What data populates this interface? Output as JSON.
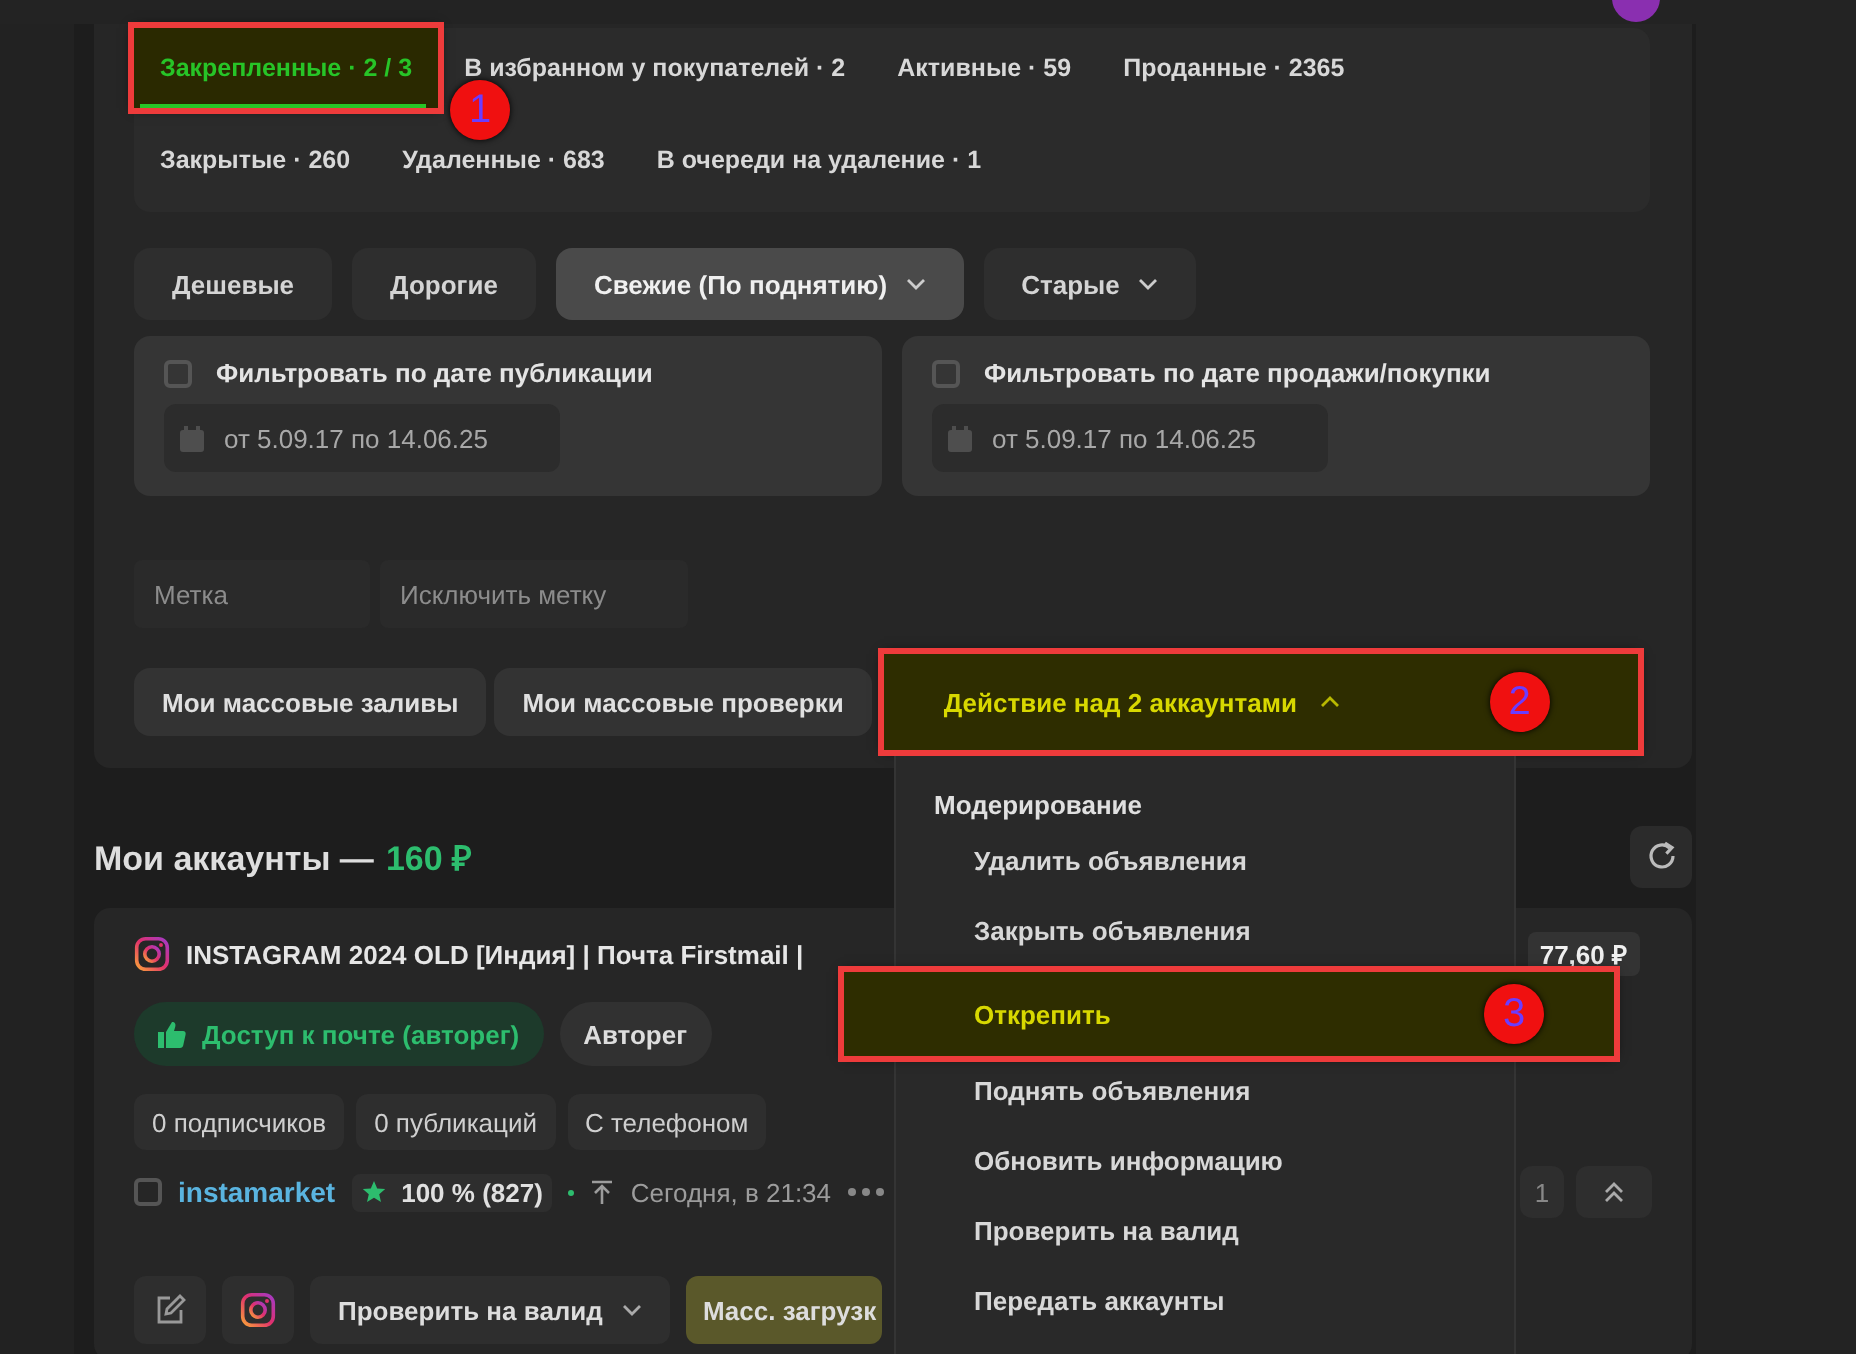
{
  "tab_rows": [
    [
      {
        "label": "Закрепленные · 2 / 3",
        "selected": true,
        "marker": "1"
      },
      {
        "label": "В избранном у покупателей · 2",
        "selected": false
      },
      {
        "label": "Активные · 59",
        "selected": false
      },
      {
        "label": "Проданные · 2365",
        "selected": false
      }
    ],
    [
      {
        "label": "Закрытые · 260",
        "selected": false
      },
      {
        "label": "Удаленные · 683",
        "selected": false
      },
      {
        "label": "В очереди на удаление · 1",
        "selected": false
      }
    ]
  ],
  "sort_buttons": [
    {
      "label": "Дешевые",
      "selected": false,
      "has_caret": false
    },
    {
      "label": "Дорогие",
      "selected": false,
      "has_caret": false
    },
    {
      "label": "Свежие (По поднятию)",
      "selected": true,
      "has_caret": true
    },
    {
      "label": "Старые",
      "selected": false,
      "has_caret": true
    }
  ],
  "date_filters": [
    {
      "label": "Фильтровать по дате публикации",
      "checked": false,
      "range": "от 5.09.17 по 14.06.25"
    },
    {
      "label": "Фильтровать по дате продажи/покупки",
      "checked": false,
      "range": "от 5.09.17 по 14.06.25"
    }
  ],
  "tag_fields": [
    {
      "placeholder": "Метка"
    },
    {
      "placeholder": "Исключить метку"
    }
  ],
  "action_buttons": [
    {
      "label": "Мои массовые заливы",
      "kind": "plain"
    },
    {
      "label": "Мои массовые проверки",
      "kind": "plain"
    },
    {
      "label": "Действие над 2 аккаунтами",
      "kind": "dropdown",
      "expanded": true,
      "marker": "2"
    }
  ],
  "section": {
    "title": "Мои аккаунты —",
    "amount": "160 ₽"
  },
  "account": {
    "title": "INSTAGRAM 2024 OLD [Индия] | Почта Firstmail |",
    "price": "77,60 ₽",
    "badges": [
      {
        "label": "Доступ к почте (авторег)",
        "kind": "success"
      },
      {
        "label": "Авторег",
        "kind": "plain"
      }
    ],
    "tags": [
      "0 подписчиков",
      "0 публикаций",
      "С телефоном"
    ],
    "checked": false,
    "seller": "instamarket",
    "rating": "100 % (827)",
    "time": "Сегодня, в 21:34",
    "counter": "1",
    "buttons": [
      {
        "kind": "edit"
      },
      {
        "kind": "instagram"
      },
      {
        "kind": "dropdown",
        "label": "Проверить на валид"
      },
      {
        "kind": "accent",
        "label": "Масс. загрузк"
      }
    ]
  },
  "menu": {
    "heading": "Модерирование",
    "items": [
      {
        "label": "Удалить объявления",
        "selected": false
      },
      {
        "label": "Закрыть объявления",
        "selected": false
      },
      {
        "label": "Открепить",
        "selected": true,
        "marker": "3"
      },
      {
        "label": "Поднять объявления",
        "selected": false
      },
      {
        "label": "Обновить информацию",
        "selected": false
      },
      {
        "label": "Проверить на валид",
        "selected": false
      },
      {
        "label": "Передать аккаунты",
        "selected": false
      }
    ]
  }
}
